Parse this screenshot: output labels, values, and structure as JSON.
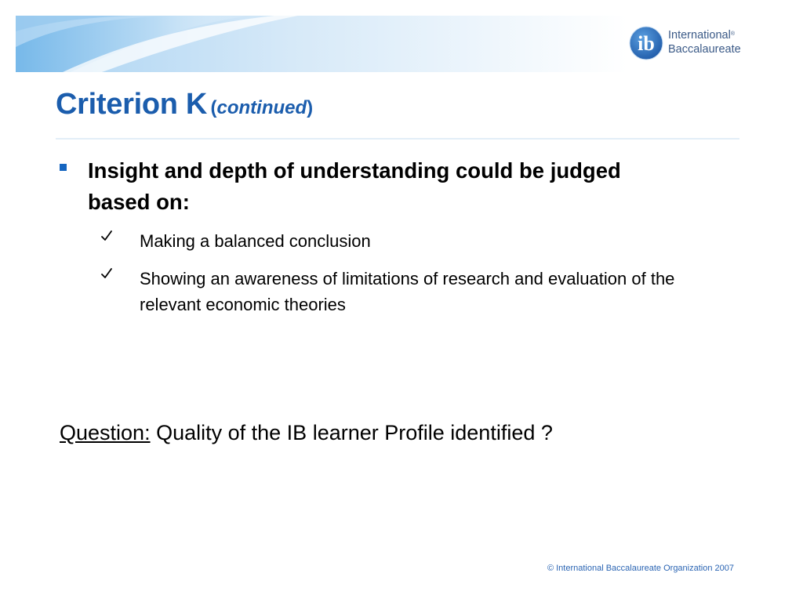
{
  "header": {
    "logo_line1": "International",
    "logo_line2": "Baccalaureate",
    "logo_registered": "®",
    "logo_mark_letters": "ib"
  },
  "title": {
    "main": "Criterion K",
    "open_paren": "(",
    "italic": "continued",
    "close_paren": ")"
  },
  "bullet": {
    "text": "Insight and depth of understanding could be judged based on:",
    "sub_items": [
      "Making a balanced conclusion",
      "Showing an awareness of limitations of research and evaluation of the relevant economic theories"
    ]
  },
  "question": {
    "label": "Question:",
    "text": "Quality of the IB learner Profile identified ?"
  },
  "footer": {
    "copyright": "© International Baccalaureate Organization 2007"
  },
  "colors": {
    "title": "#1b5dad",
    "bullet": "#1565c0",
    "banner_light": "#dcebf8",
    "banner_mid": "#9ecbef",
    "footer": "#2a64b3"
  }
}
